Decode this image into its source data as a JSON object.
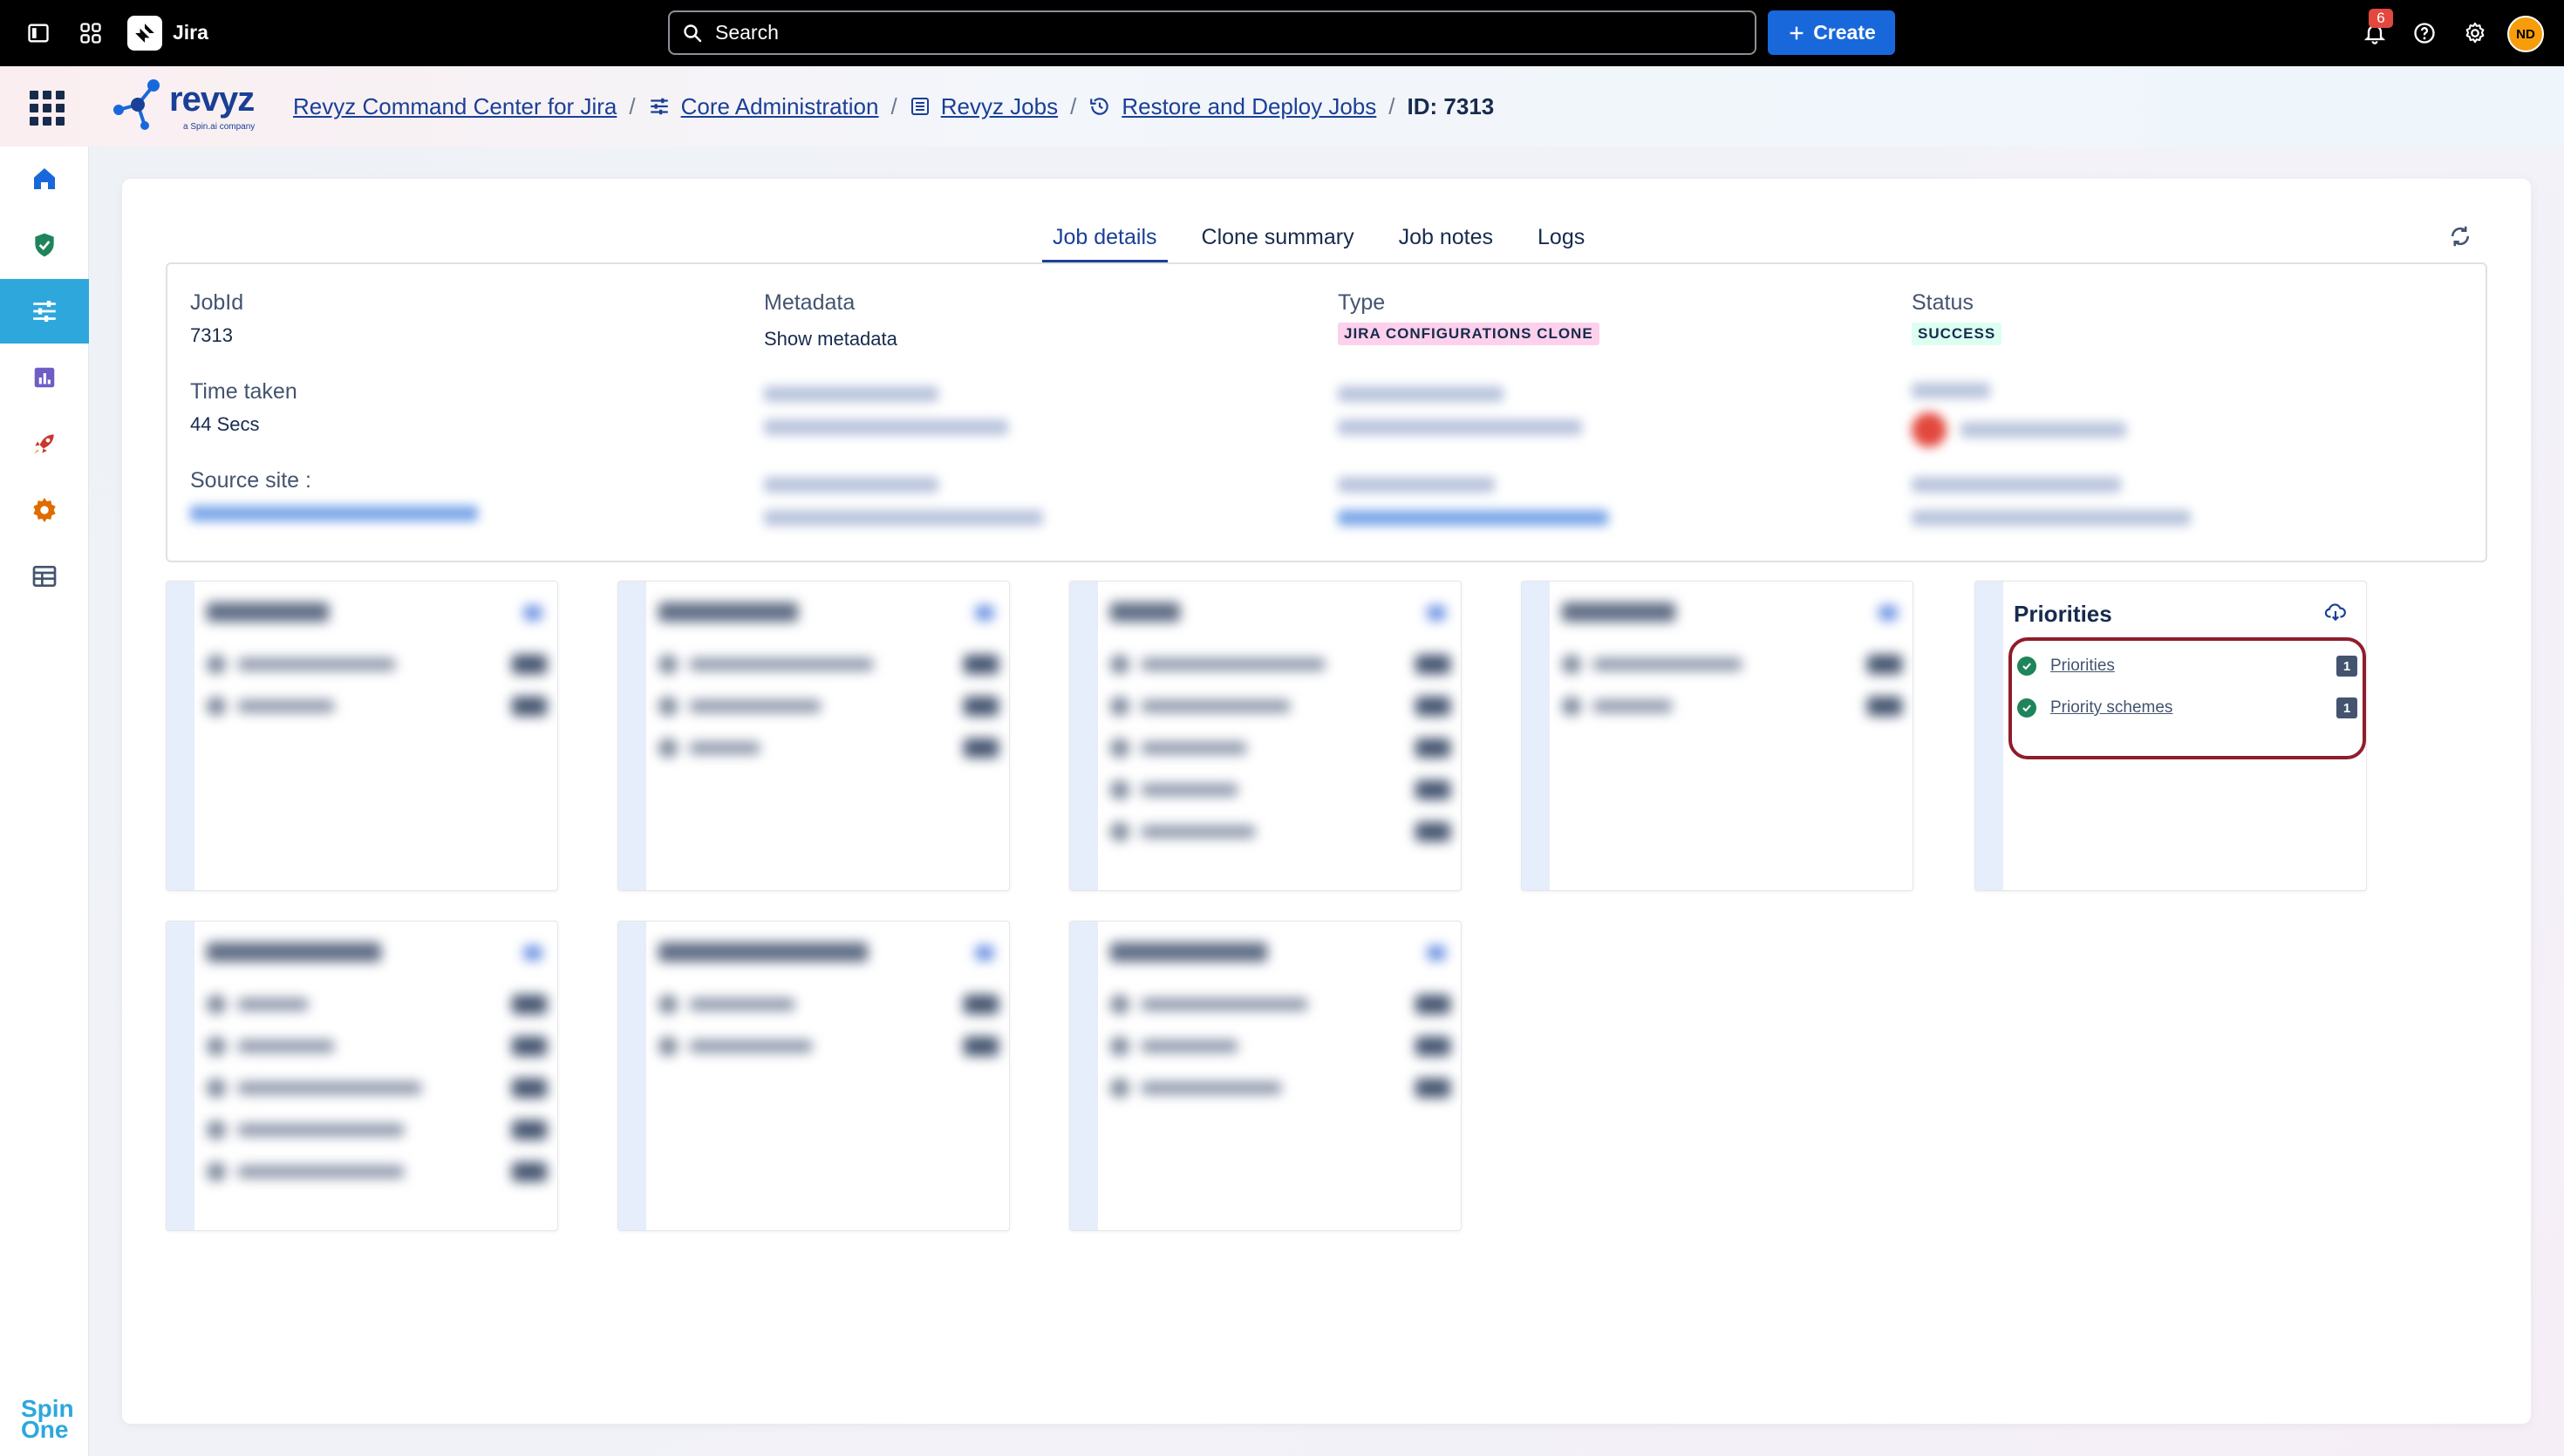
{
  "topbar": {
    "app_name": "Jira",
    "search_label": "Search",
    "create_label": "Create",
    "notification_count": "6",
    "avatar_initials": "ND"
  },
  "brand": {
    "name": "revyz",
    "tagline": "a Spin.ai company"
  },
  "breadcrumb": {
    "items": [
      {
        "label": "Revyz Command Center for Jira",
        "icon": "none"
      },
      {
        "label": "Core Administration",
        "icon": "sliders-icon"
      },
      {
        "label": "Revyz Jobs",
        "icon": "list-icon"
      },
      {
        "label": "Restore and Deploy Jobs",
        "icon": "history-icon"
      }
    ],
    "current": "ID: 7313"
  },
  "sidebar": {
    "items": [
      {
        "name": "home-icon",
        "color": "#1868db"
      },
      {
        "name": "shield-check-icon",
        "color": "#1f845a"
      },
      {
        "name": "sliders-icon",
        "color": "#ffffff",
        "active": true
      },
      {
        "name": "chart-icon",
        "color": "#6e5dc6"
      },
      {
        "name": "rocket-icon",
        "color": "#c9372c"
      },
      {
        "name": "gear-icon",
        "color": "#e06c00"
      },
      {
        "name": "table-icon",
        "color": "#44546f"
      }
    ],
    "footer_line1": "Spin",
    "footer_line2": "One"
  },
  "tabs": [
    {
      "label": "Job details",
      "active": true
    },
    {
      "label": "Clone summary",
      "active": false
    },
    {
      "label": "Job notes",
      "active": false
    },
    {
      "label": "Logs",
      "active": false
    }
  ],
  "job": {
    "jobid_label": "JobId",
    "jobid_value": "7313",
    "metadata_label": "Metadata",
    "metadata_value": "Show metadata",
    "type_label": "Type",
    "type_value": "JIRA CONFIGURATIONS CLONE",
    "status_label": "Status",
    "status_value": "SUCCESS",
    "time_label": "Time taken",
    "time_value": "44 Secs",
    "source_label": "Source site :"
  },
  "priorities_card": {
    "title": "Priorities",
    "rows": [
      {
        "label": "Priorities",
        "count": "1"
      },
      {
        "label": "Priority schemes",
        "count": "1"
      }
    ]
  },
  "colors": {
    "accent": "#1a3f96",
    "create_button": "#1868db",
    "highlight_outline": "#8f1d2b",
    "success": "#1f845a"
  }
}
